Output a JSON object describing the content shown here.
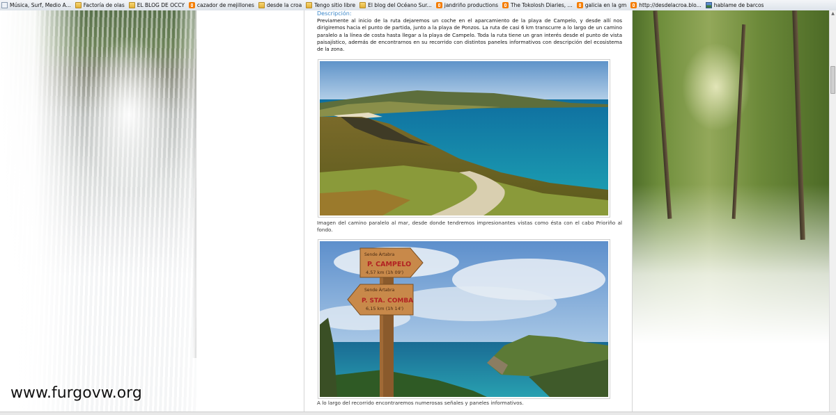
{
  "bookmarks": [
    {
      "label": "Música, Surf, Medio A...",
      "icon": "page-icon"
    },
    {
      "label": "Factoría de olas",
      "icon": "folder-icon"
    },
    {
      "label": "EL BLOG DE OCCY",
      "icon": "folder-icon"
    },
    {
      "label": "cazador de mejillones",
      "icon": "blogger-icon"
    },
    {
      "label": "desde la croa",
      "icon": "folder-icon"
    },
    {
      "label": "Tengo sitio libre",
      "icon": "folder-icon"
    },
    {
      "label": "El blog del Océano Sur...",
      "icon": "folder-icon"
    },
    {
      "label": "jandriño productions",
      "icon": "blogger-icon"
    },
    {
      "label": "The Tokolosh Diaries, ...",
      "icon": "blogger-icon"
    },
    {
      "label": "galicia en la gm",
      "icon": "blogger-icon"
    },
    {
      "label": "http://desdelacroa.blo...",
      "icon": "blogger-icon"
    },
    {
      "label": "hablame de barcos",
      "icon": "image-icon"
    }
  ],
  "article": {
    "section_title": "Descripción:",
    "description": "Previamente al inicio de la ruta dejaremos un coche en el aparcamiento de la playa de Campelo, y desde allí nos dirigiremos hacia el punto de partida, junto a la playa de Ponzos. La ruta de casi 6 km transcurre a lo largo de un camino paralelo a la línea de costa hasta llegar a la playa de Campelo. Toda la ruta tiene un gran interés desde el punto de vista paisajístico, además de encontrarnos en su recorrido con distintos paneles informativos con descripción del ecosistema de la zona.",
    "photo1_caption": "Imagen del camino paralelo al mar, desde donde tendremos impresionantes vistas como ésta con el cabo Prioriño al fondo.",
    "photo2_caption": "A lo largo del recorrido encontraremos numerosas señales y paneles informativos.",
    "signpost": {
      "top_sign": {
        "header": "Sende Ártabra",
        "destination": "P. CAMPELO",
        "distance": "4,57 km (1h 09')"
      },
      "bottom_sign": {
        "header": "Sende Ártabra",
        "destination": "P. STA. COMBA",
        "distance": "6,15 km (1h 14')"
      }
    }
  },
  "watermark": "www.furgovw.org",
  "colors": {
    "section_title": "#3a86c8",
    "sea": "#1a8fa6",
    "sky": "#7fb2df",
    "sign_wood": "#c8894a"
  }
}
